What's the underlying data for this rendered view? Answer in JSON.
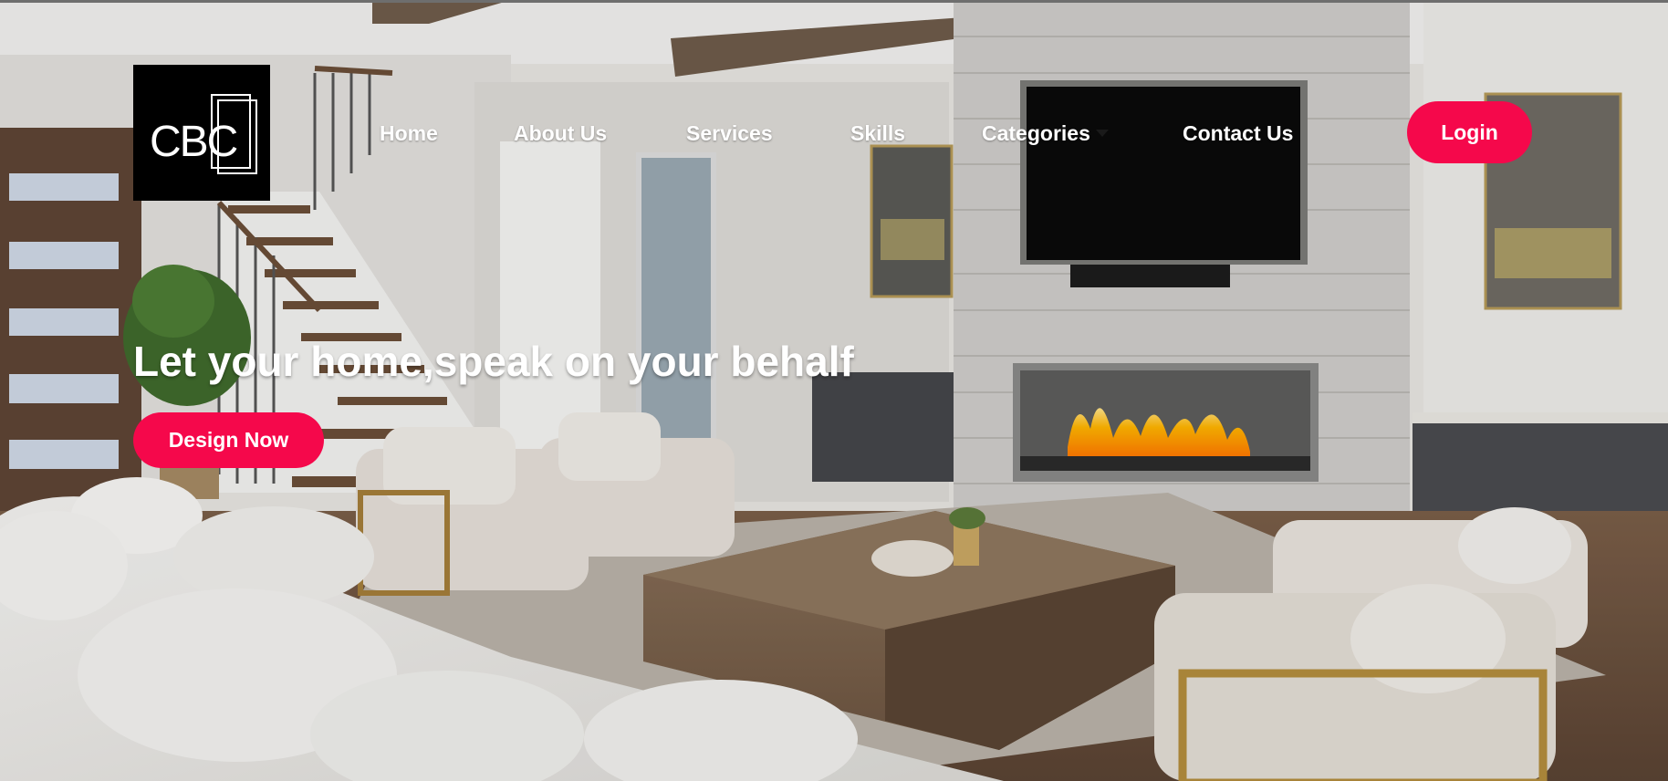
{
  "brand": {
    "logo_text": "CBC"
  },
  "nav": {
    "items": [
      {
        "label": "Home"
      },
      {
        "label": "About Us"
      },
      {
        "label": "Services"
      },
      {
        "label": "Skills"
      },
      {
        "label": "Categories",
        "has_dropdown": true
      },
      {
        "label": "Contact Us"
      }
    ],
    "login_label": "Login"
  },
  "hero": {
    "headline": "Let your home,speak on your behalf",
    "cta_label": "Design Now"
  },
  "colors": {
    "accent": "#f5084b",
    "logo_bg": "#000000",
    "nav_text": "#ffffff"
  }
}
